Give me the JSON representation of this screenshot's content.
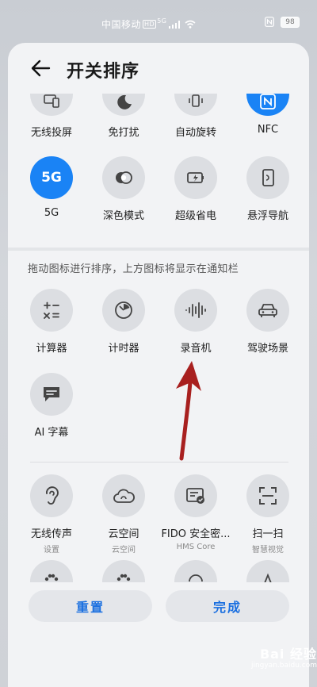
{
  "status_bar": {
    "carrier": "中国移动",
    "hd": "HD",
    "network": "5G",
    "battery": "98"
  },
  "header": {
    "title": "开关排序"
  },
  "active_tiles": [
    {
      "label": "无线投屏",
      "icon": "screen-cast-icon"
    },
    {
      "label": "免打扰",
      "icon": "moon-icon"
    },
    {
      "label": "自动旋转",
      "icon": "rotate-icon"
    },
    {
      "label": "NFC",
      "icon": "nfc-icon"
    },
    {
      "label": "5G",
      "icon": "5g-icon",
      "icon_text": "5G"
    },
    {
      "label": "深色模式",
      "icon": "dark-mode-icon"
    },
    {
      "label": "超级省电",
      "icon": "battery-saver-icon"
    },
    {
      "label": "悬浮导航",
      "icon": "floating-nav-icon"
    }
  ],
  "hint": "拖动图标进行排序，上方图标将显示在通知栏",
  "inactive_tiles": [
    {
      "label": "计算器",
      "icon": "calculator-icon"
    },
    {
      "label": "计时器",
      "icon": "timer-icon"
    },
    {
      "label": "录音机",
      "icon": "voice-recorder-icon"
    },
    {
      "label": "驾驶场景",
      "icon": "car-icon"
    },
    {
      "label": "AI 字幕",
      "icon": "subtitle-icon"
    }
  ],
  "available_tiles": [
    {
      "label": "无线传声",
      "sub": "设置",
      "icon": "ear-icon"
    },
    {
      "label": "云空间",
      "sub": "云空间",
      "icon": "cloud-icon"
    },
    {
      "label": "FIDO 安全密...",
      "sub": "HMS Core",
      "icon": "security-key-icon"
    },
    {
      "label": "扫一扫",
      "sub": "智慧视觉",
      "icon": "scan-icon"
    }
  ],
  "buttons": {
    "reset": "重置",
    "done": "完成"
  },
  "watermark": {
    "brand": "Bai 经验",
    "url": "jingyan.baidu.com"
  },
  "colors": {
    "accent": "#1a83f5",
    "button_text": "#1a6fe0",
    "arrow": "#a8201f"
  }
}
